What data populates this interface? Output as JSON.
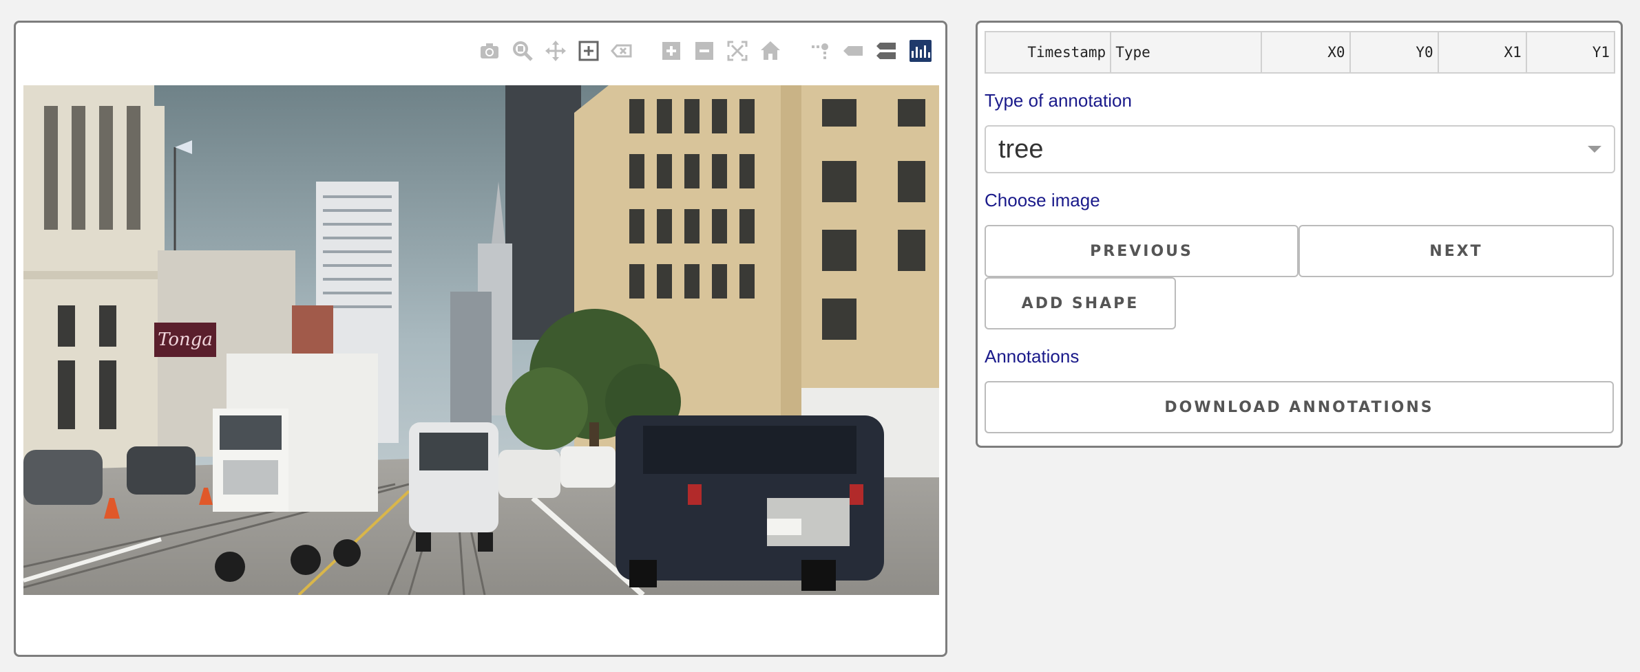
{
  "toolbar": {
    "icons": [
      "camera-icon",
      "zoom-icon",
      "pan-icon",
      "box-select-icon",
      "lasso-erase-icon",
      "zoom-in-icon",
      "zoom-out-icon",
      "autoscale-icon",
      "reset-axes-icon",
      "spike-lines-icon",
      "hover-closest-icon",
      "hover-compare-icon",
      "plotly-logo-icon"
    ]
  },
  "table": {
    "headers": [
      "Timestamp",
      "Type",
      "X0",
      "Y0",
      "X1",
      "Y1"
    ]
  },
  "type_label": "Type of annotation",
  "type_value": "tree",
  "choose_label": "Choose image",
  "previous_label": "PREVIOUS",
  "next_label": "NEXT",
  "add_shape_label": "ADD SHAPE",
  "annotations_label": "Annotations",
  "download_label": "DOWNLOAD ANNOTATIONS",
  "image": {
    "storefront_sign": "Tonga"
  }
}
